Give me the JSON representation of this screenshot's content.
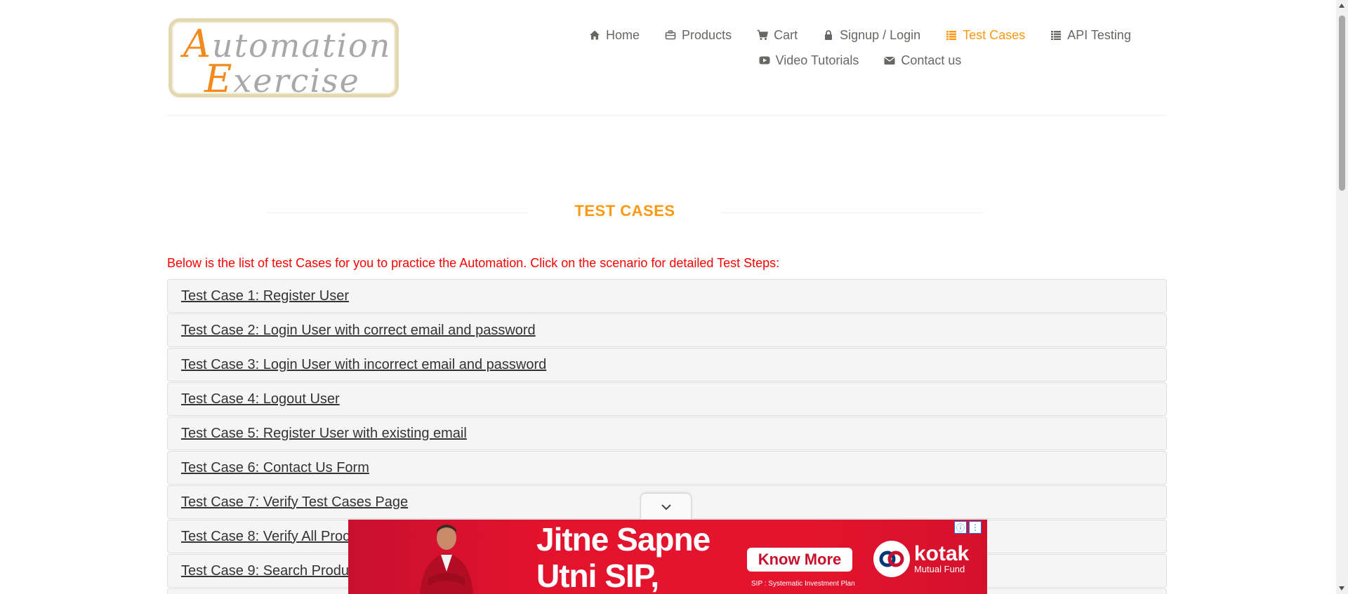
{
  "logo": {
    "line1_first": "A",
    "line1_rest": "utomation",
    "line2_first": "E",
    "line2_rest": "xercise"
  },
  "nav": [
    {
      "label": "Home",
      "icon": "home-icon",
      "active": false
    },
    {
      "label": "Products",
      "icon": "briefcase-icon",
      "active": false
    },
    {
      "label": "Cart",
      "icon": "cart-icon",
      "active": false
    },
    {
      "label": "Signup / Login",
      "icon": "lock-icon",
      "active": false
    },
    {
      "label": "Test Cases",
      "icon": "list-icon",
      "active": true
    },
    {
      "label": "API Testing",
      "icon": "list-icon",
      "active": false
    },
    {
      "label": "Video Tutorials",
      "icon": "youtube-icon",
      "active": false
    },
    {
      "label": "Contact us",
      "icon": "envelope-icon",
      "active": false
    }
  ],
  "page": {
    "title": "TEST CASES",
    "intro": "Below is the list of test Cases for you to practice the Automation. Click on the scenario for detailed Test Steps:"
  },
  "test_cases": [
    "Test Case 1: Register User",
    "Test Case 2: Login User with correct email and password",
    "Test Case 3: Login User with incorrect email and password",
    "Test Case 4: Logout User",
    "Test Case 5: Register User with existing email",
    "Test Case 6: Contact Us Form",
    "Test Case 7: Verify Test Cases Page",
    "Test Case 8: Verify All Proc",
    "Test Case 9: Search Produ"
  ],
  "ad": {
    "headline_line1": "Jitne Sapne",
    "headline_line2": "Utni SIP,",
    "cta": "Know More",
    "disclaimer": "SIP : Systematic Investment Plan",
    "brand_name": "kotak",
    "brand_sub": "Mutual Fund",
    "info_glyph": "ⓘ",
    "menu_glyph": "⋮"
  },
  "colors": {
    "accent": "#fe980f",
    "intro_red": "#fe0000",
    "nav_text": "#696763",
    "ad_red": "#e3122d"
  }
}
